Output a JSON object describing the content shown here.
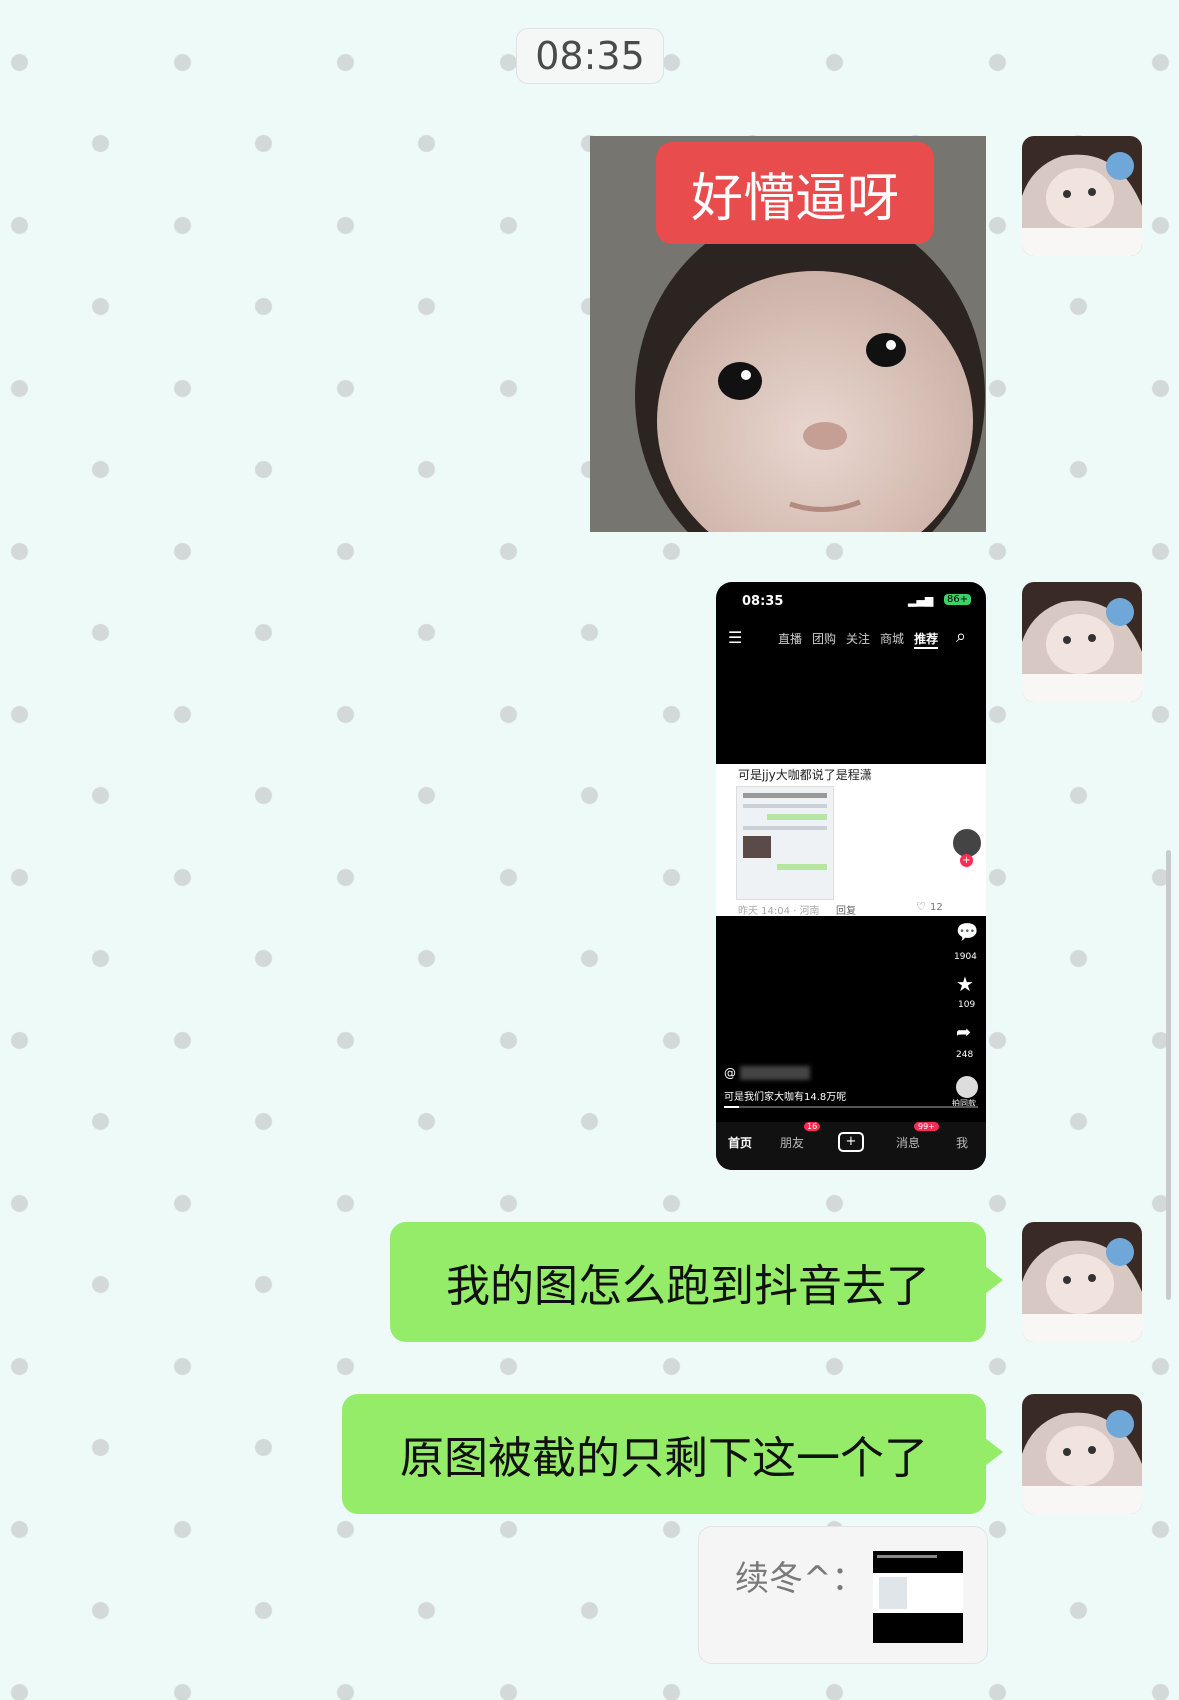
{
  "timestamp": "08:35",
  "messages": [
    {
      "type": "image",
      "caption": "好懵逼呀"
    },
    {
      "type": "image",
      "content": "douyin-screenshot"
    },
    {
      "type": "text",
      "text": "我的图怎么跑到抖音去了"
    },
    {
      "type": "text",
      "text": "原图被截的只剩下这一个了"
    }
  ],
  "quote": {
    "author": "续冬^："
  },
  "phone_screenshot": {
    "status_time": "08:35",
    "battery": "86+",
    "tabs": [
      "直播",
      "团购",
      "关注",
      "商城",
      "推荐"
    ],
    "comment_text": "可是jjy大咖都说了是程潇",
    "comment_meta": "昨天 14:04 · 河南",
    "reply_label": "回复",
    "comment_likes": "12",
    "counts": {
      "comments": "1904",
      "stars": "109",
      "shares": "248"
    },
    "same_label": "拍同款",
    "at": "@",
    "desc": "可是我们家大咖有14.8万呢",
    "nav": [
      "首页",
      "朋友",
      "消息",
      "我"
    ],
    "badges": {
      "friends": "16",
      "messages": "99+"
    }
  },
  "colors": {
    "bubble": "#95ec69",
    "background": "#eefaf8",
    "sticker_banner": "#e84c4c"
  }
}
